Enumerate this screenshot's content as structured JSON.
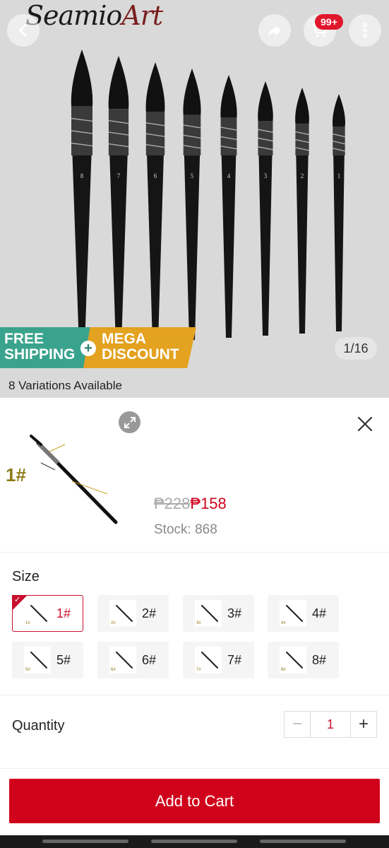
{
  "header": {
    "brand": "Seamio",
    "brand_script": "Art",
    "cart_badge": "99+",
    "icons": [
      "back-arrow-icon",
      "share-icon",
      "cart-icon",
      "more-vertical-icon"
    ]
  },
  "gallery": {
    "promo_left": "FREE SHIPPING",
    "promo_plus": "+",
    "promo_right": "MEGA DISCOUNT",
    "counter": "1/16",
    "brush_numbers": [
      "8",
      "7",
      "6",
      "5",
      "4",
      "3",
      "2",
      "1"
    ]
  },
  "variations_text": "8 Variations Available",
  "sheet": {
    "thumb_label": "1#",
    "price_old": "₱228",
    "price_new": "₱158",
    "stock": "Stock: 868",
    "size_title": "Size",
    "sizes": [
      {
        "label": "1#",
        "img_label": "1#",
        "selected": true
      },
      {
        "label": "2#",
        "img_label": "2#",
        "selected": false
      },
      {
        "label": "3#",
        "img_label": "3#",
        "selected": false
      },
      {
        "label": "4#",
        "img_label": "4#",
        "selected": false
      },
      {
        "label": "5#",
        "img_label": "5#",
        "selected": false
      },
      {
        "label": "6#",
        "img_label": "6#",
        "selected": false
      },
      {
        "label": "7#",
        "img_label": "7#",
        "selected": false
      },
      {
        "label": "8#",
        "img_label": "8#",
        "selected": false
      }
    ],
    "quantity_title": "Quantity",
    "quantity_value": "1",
    "minus": "−",
    "plus": "+",
    "add_to_cart": "Add to Cart"
  },
  "colors": {
    "accent": "#d0021b",
    "overlay": "#d9d9d9",
    "promo_green": "#3aa38d",
    "promo_orange": "#e3a21f"
  }
}
